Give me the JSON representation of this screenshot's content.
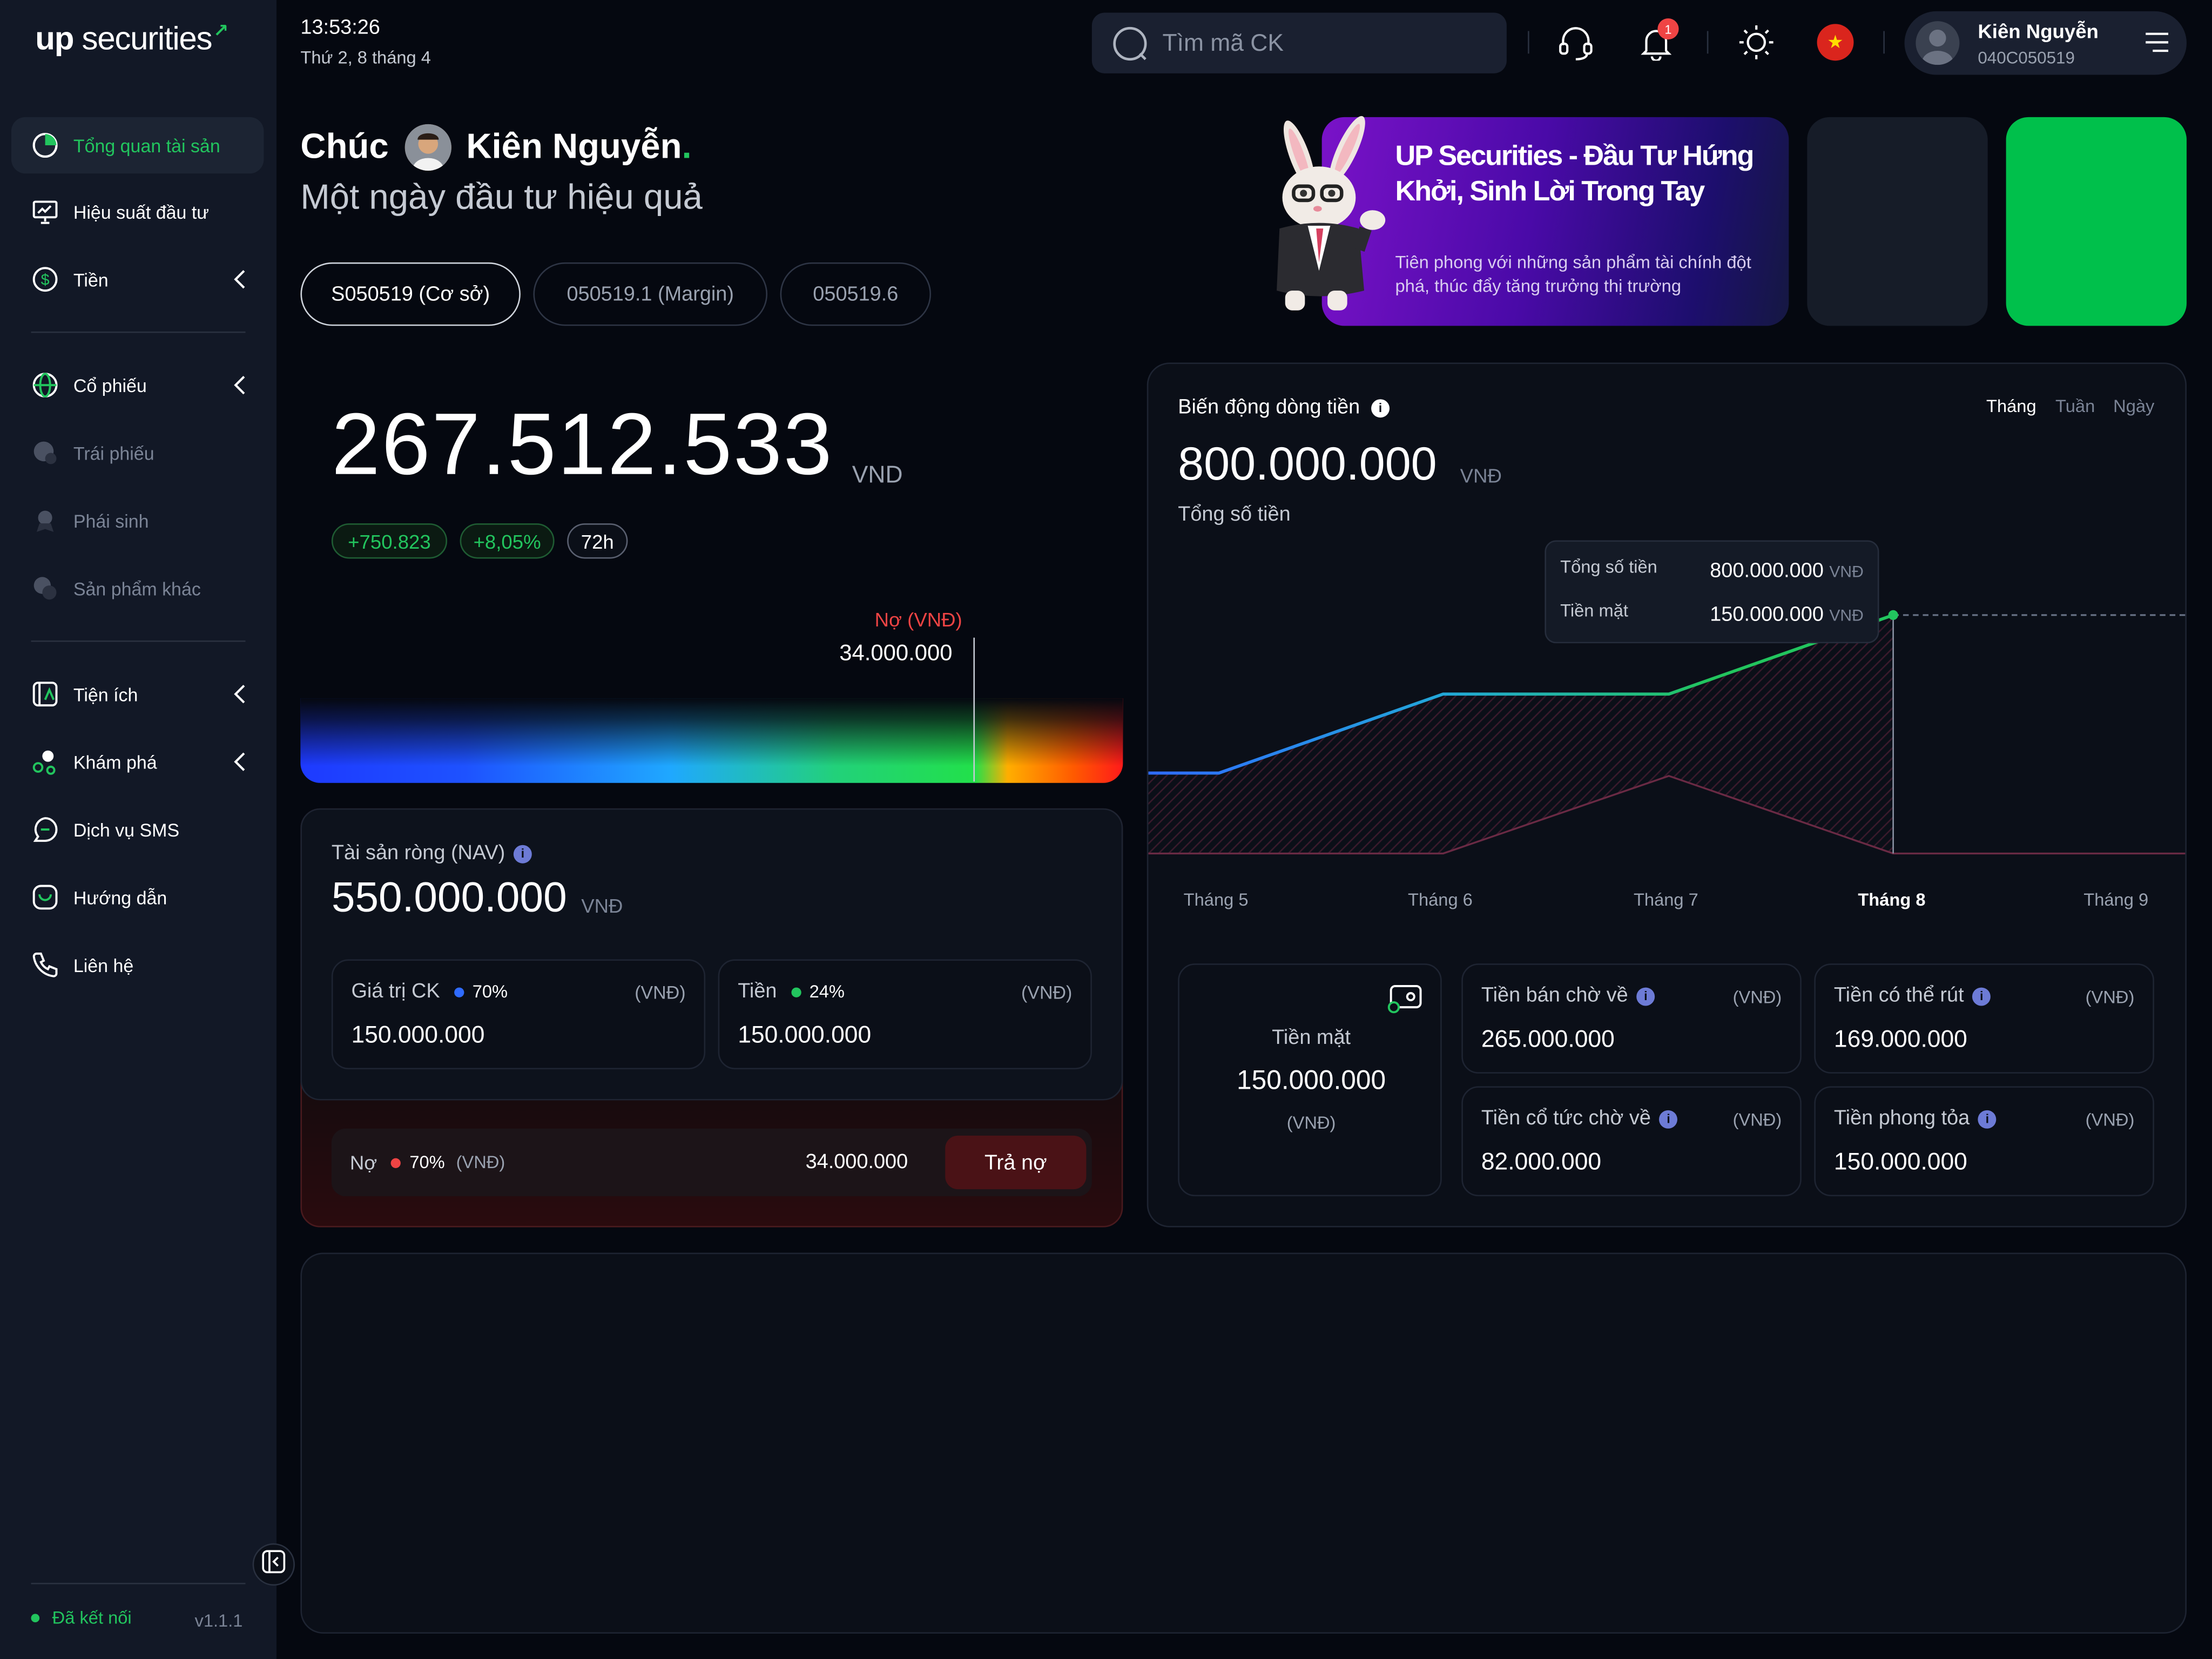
{
  "brand": {
    "name_bold": "up",
    "name_rest": " securities",
    "arrow": "↗"
  },
  "header": {
    "time": "13:53:26",
    "date": "Thứ 2, 8 tháng 4",
    "search_placeholder": "Tìm mã CK",
    "notification_count": "1",
    "flag_star": "★",
    "user_name": "Kiên Nguyễn",
    "user_id": "040C050519"
  },
  "sidebar": {
    "items": [
      {
        "label": "Tổng quan tài sản",
        "icon": "pie-chart-icon",
        "active": true
      },
      {
        "label": "Hiệu suất đầu tư",
        "icon": "presentation-chart-icon"
      },
      {
        "label": "Tiền",
        "icon": "dollar-circle-icon",
        "expandable": true
      },
      {
        "label": "Cổ phiếu",
        "icon": "globe-icon",
        "expandable": true
      },
      {
        "label": "Trái phiếu",
        "icon": "bond-icon",
        "disabled": true
      },
      {
        "label": "Phái sinh",
        "icon": "derivative-icon",
        "disabled": true
      },
      {
        "label": "Sản phẩm khác",
        "icon": "other-products-icon",
        "disabled": true
      },
      {
        "label": "Tiện ích",
        "icon": "utility-icon",
        "expandable": true
      },
      {
        "label": "Khám phá",
        "icon": "explore-icon",
        "expandable": true
      },
      {
        "label": "Dịch vụ SMS",
        "icon": "sms-icon"
      },
      {
        "label": "Hướng dẫn",
        "icon": "guide-icon"
      },
      {
        "label": "Liên hệ",
        "icon": "phone-icon"
      }
    ],
    "status": "Đã kết nối",
    "version": "v1.1.1"
  },
  "greeting": {
    "hello": "Chúc",
    "name": "Kiên Nguyễn",
    "dot": ".",
    "subtitle": "Một ngày đầu tư hiệu quả"
  },
  "accounts": [
    {
      "label": "S050519 (Cơ sở)",
      "active": true
    },
    {
      "label": "050519.1 (Margin)"
    },
    {
      "label": "050519.6"
    }
  ],
  "promo": {
    "title": "UP Securities - Đầu Tư Hứng Khởi, Sinh Lời Trong Tay",
    "description": "Tiên phong với những sản phẩm tài chính đột phá, thúc đẩy tăng trưởng thị trường"
  },
  "portfolio": {
    "total": "267.512.533",
    "unit": "VND",
    "change_abs": "+750.823",
    "change_pct": "+8,05%",
    "period": "72h",
    "debt_label": "Nợ (VNĐ)",
    "debt_value": "34.000.000"
  },
  "nav": {
    "label": "Tài sản ròng (NAV)",
    "value": "550.000.000",
    "unit": "VNĐ",
    "stock": {
      "label": "Giá trị CK",
      "pct": "70%",
      "unit": "(VNĐ)",
      "value": "150.000.000",
      "color": "#2f6bff"
    },
    "cash": {
      "label": "Tiền",
      "pct": "24%",
      "unit": "(VNĐ)",
      "value": "150.000.000",
      "color": "#22c55e"
    },
    "debt": {
      "label": "Nợ",
      "pct": "70%",
      "unit": "(VNĐ)",
      "value": "34.000.000",
      "button": "Trả nợ",
      "color": "#ef4444"
    }
  },
  "cashflow": {
    "title": "Biến động dòng tiền",
    "periods": [
      "Tháng",
      "Tuần",
      "Ngày"
    ],
    "amount": "800.000.000",
    "unit": "VNĐ",
    "subtitle": "Tổng số tiền",
    "tooltip": {
      "total_label": "Tổng số tiền",
      "total_value": "800.000.000",
      "total_unit": "VNĐ",
      "cash_label": "Tiền mặt",
      "cash_value": "150.000.000",
      "cash_unit": "VNĐ"
    },
    "months": [
      "Tháng 5",
      "Tháng 6",
      "Tháng 7",
      "Tháng 8",
      "Tháng 9"
    ],
    "active_month": "Tháng 8",
    "cash_card": {
      "label": "Tiền mặt",
      "value": "150.000.000",
      "unit": "(VNĐ)"
    },
    "cards": [
      {
        "label": "Tiền bán chờ về",
        "unit": "(VNĐ)",
        "value": "265.000.000"
      },
      {
        "label": "Tiền có thể rút",
        "unit": "(VNĐ)",
        "value": "169.000.000"
      },
      {
        "label": "Tiền cổ tức chờ về",
        "unit": "(VNĐ)",
        "value": "82.000.000"
      },
      {
        "label": "Tiền phong tỏa",
        "unit": "(VNĐ)",
        "value": "150.000.000"
      }
    ]
  }
}
